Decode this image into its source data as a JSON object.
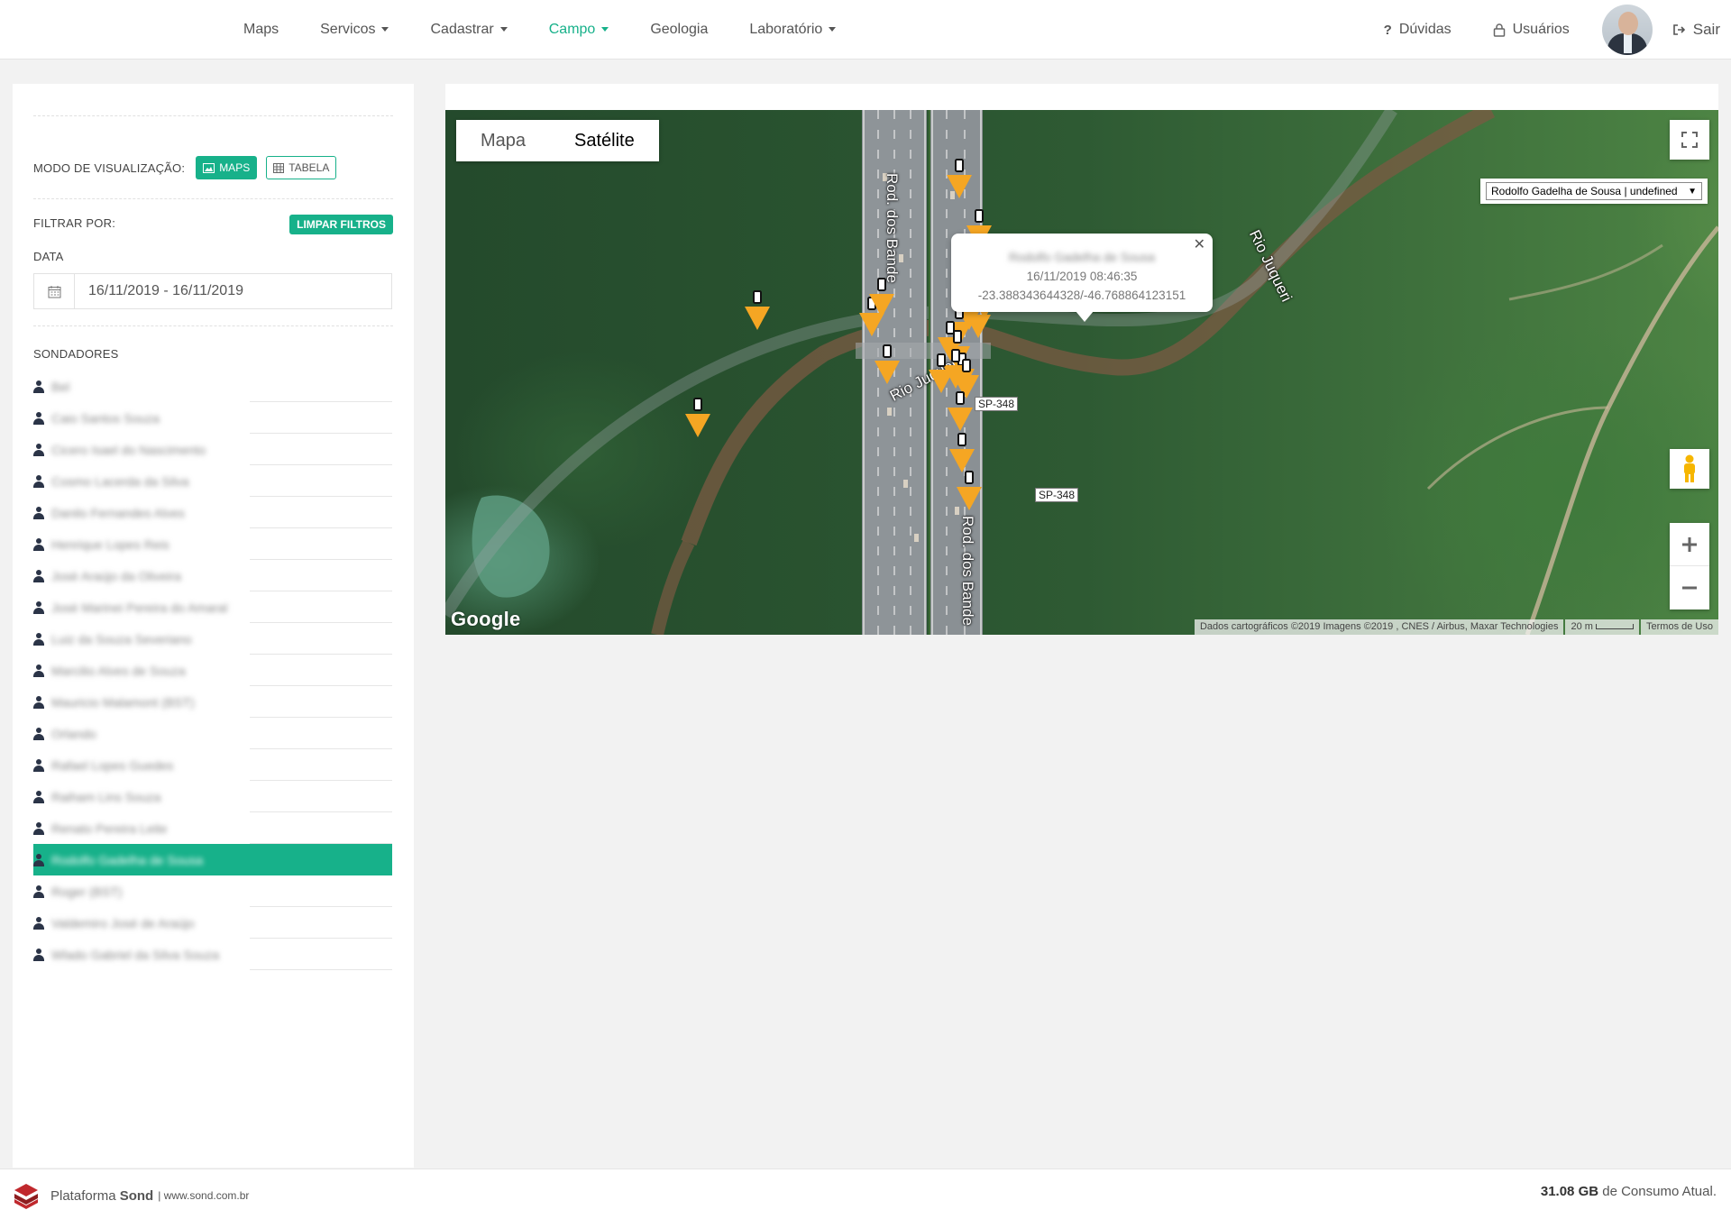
{
  "nav": {
    "maps": "Maps",
    "servicos": "Servicos",
    "cadastrar": "Cadastrar",
    "campo": "Campo",
    "geologia": "Geologia",
    "laboratorio": "Laboratório",
    "duvidas_icon": "?",
    "duvidas": "Dúvidas",
    "usuarios": "Usuários",
    "sair": "Sair"
  },
  "colors": {
    "accent": "#17b18a",
    "marker": "#f5a623"
  },
  "sidebar": {
    "mode_label": "MODO DE VISUALIZAÇÃO:",
    "maps_label": "MAPS",
    "tabela_label": "TABELA",
    "filter_label": "FILTRAR POR:",
    "clear_label": "LIMPAR FILTROS",
    "date_label": "DATA",
    "date_value": "16/11/2019 - 16/11/2019",
    "sondadores_label": "SONDADORES",
    "sondadores": [
      "Bel",
      "Caio Santos Souza",
      "Cicero Isael do Nascimento",
      "Cosmo Lacerda da Silva",
      "Danilo Fernandes Alves",
      "Henrique Lopes Reis",
      "Josè Araújo da Oliveira",
      "Josè Marinei Pereira do Amaral",
      "Luiz da Souza Severiano",
      "Marcilio Alves de Souza",
      "Mauricio Malamont (BST)",
      "Orlando",
      "Rafael Lopes Guedes",
      "Raiham Lins Souza",
      "Renato Pereira Leite",
      "Rodolfo Gadelha de Sousa",
      "Roger (BST)",
      "Valdemiro José de Araújo",
      "Wlado Gabriel da Silva Souza"
    ],
    "active_index": 15
  },
  "map": {
    "type_map": "Mapa",
    "type_satellite": "Satélite",
    "selected_user": "Rodolfo Gadelha de Sousa | undefined",
    "infowindow": {
      "name": "Rodolfo Gadelha de Sousa",
      "datetime": "16/11/2019 08:46:35",
      "coords": "-23.388343644328/-46.768864123151"
    },
    "google": "Google",
    "attribution": "Dados cartográficos ©2019 Imagens ©2019 , CNES / Airbus, Maxar Technologies",
    "scale": "20 m",
    "terms": "Termos de Uso",
    "road_label_1": "SP-348",
    "road_label_2": "SP-348",
    "street_1": "Rod. dos Bande",
    "street_2": "Rod. dos Bande",
    "river_1": "Rio Juqueri",
    "river_2": "Rio Juqueri"
  },
  "footer": {
    "brand_prefix": "Plataforma",
    "brand_name": "Sond",
    "brand_sep": "|",
    "url": "www.sond.com.br",
    "consumo_value": "31.08 GB",
    "consumo_text": "de Consumo Atual."
  }
}
